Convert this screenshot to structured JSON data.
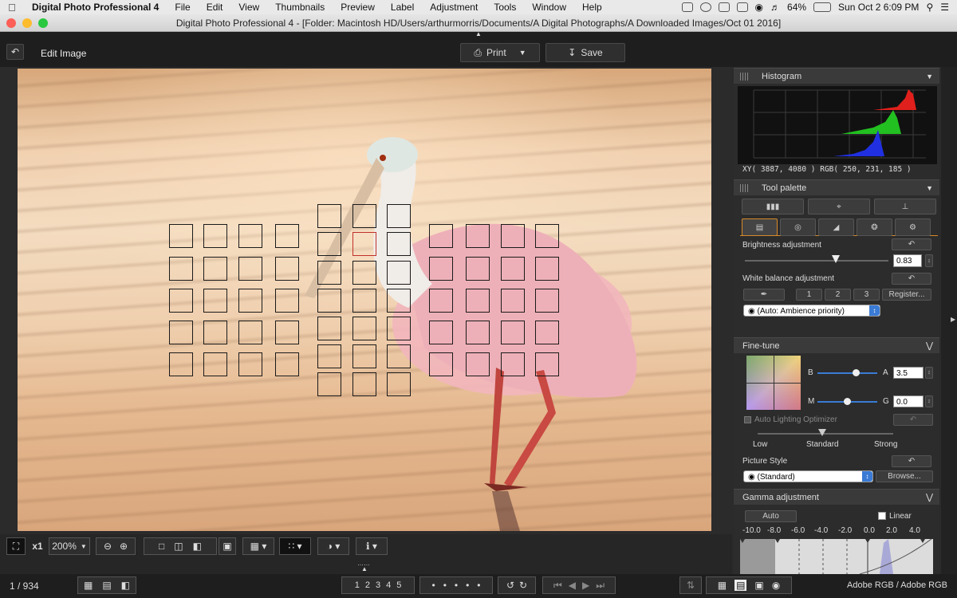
{
  "menubar": {
    "app_name": "Digital Photo Professional 4",
    "items": [
      "File",
      "Edit",
      "View",
      "Thumbnails",
      "Preview",
      "Label",
      "Adjustment",
      "Tools",
      "Window",
      "Help"
    ],
    "battery": "64%",
    "clock": "Sun Oct 2  6:09 PM"
  },
  "window": {
    "title": "Digital Photo Professional 4 - [Folder: Macintosh HD/Users/arthurmorris/Documents/A Digital Photographs/A Downloaded Images/Oct 01 2016]"
  },
  "toolbar": {
    "back_icon": "return-arrow-icon",
    "mode_label": "Edit Image",
    "print_label": "Print",
    "save_label": "Save"
  },
  "histogram": {
    "title": "Histogram",
    "readout": "XY(  3887,   4080 ) RGB( 250,  231,  185 )",
    "colors": {
      "red": "#e0201c",
      "green": "#22c020",
      "blue": "#2030e0"
    }
  },
  "tool_palette": {
    "title": "Tool palette",
    "brightness_label": "Brightness adjustment",
    "brightness_value": "0.83",
    "wb_label": "White balance adjustment",
    "wb_presets": [
      "1",
      "2",
      "3"
    ],
    "register_label": "Register...",
    "wb_mode": "(Auto: Ambience priority)"
  },
  "finetune": {
    "title": "Fine-tune",
    "b_label": "B",
    "a_label": "A",
    "a_value": "3.5",
    "m_label": "M",
    "g_label": "G",
    "g_value": "0.0",
    "alo_label": "Auto Lighting Optimizer",
    "alo_low": "Low",
    "alo_standard": "Standard",
    "alo_strong": "Strong",
    "picture_style_label": "Picture Style",
    "picture_style_value": "(Standard)",
    "browse_label": "Browse..."
  },
  "gamma": {
    "title": "Gamma adjustment",
    "auto_label": "Auto",
    "linear_label": "Linear",
    "scale": [
      "-10.0",
      "-8.0",
      "-6.0",
      "-4.0",
      "-2.0",
      "0.0",
      "2.0",
      "4.0"
    ]
  },
  "viewbar": {
    "zoom_x1": "x1",
    "zoom_level": "200%"
  },
  "status": {
    "position": "1 / 934",
    "ratings": [
      "1",
      "2",
      "3",
      "4",
      "5"
    ],
    "color_space": "Adobe RGB / Adobe RGB"
  }
}
